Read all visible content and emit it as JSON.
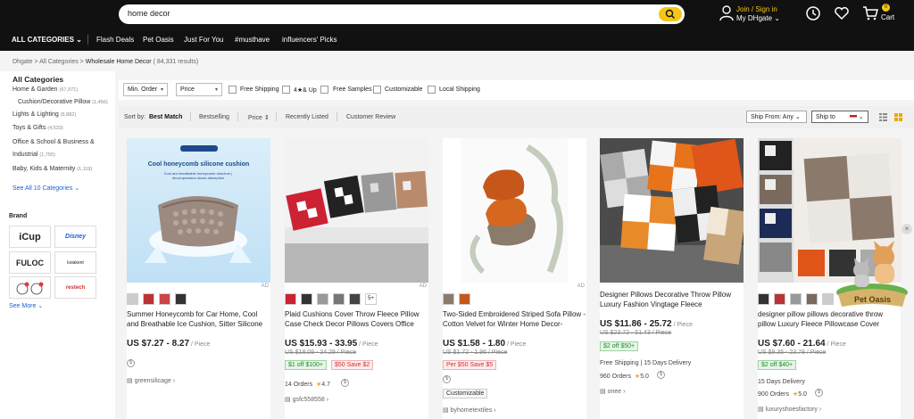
{
  "header": {
    "search_value": "home decor",
    "join_label": "Join / Sign in",
    "my_label": "My DHgate",
    "cart_count": "0",
    "cart_label": "Cart"
  },
  "nav": {
    "all_categories": "ALL CATEGORIES",
    "items": [
      "Flash Deals",
      "Pet Oasis",
      "Just For You",
      "#musthave",
      "influencers' Picks"
    ]
  },
  "breadcrumb": {
    "path": "Dhgate > All Categories > ",
    "current": "Wholesale Home Decor",
    "results": " ( 84,331  results)"
  },
  "sidebar": {
    "title": "All Categories",
    "items": [
      {
        "label": "Home & Garden",
        "count": "(67,971)"
      },
      {
        "label": "Cushion/Decorative Pillow",
        "count": "(1,456)"
      },
      {
        "label": "Lights & Lighting",
        "count": "(5,882)"
      },
      {
        "label": "Toys & Gifts",
        "count": "(4,533)"
      },
      {
        "label": "Office & School & Business &",
        "count": ""
      },
      {
        "label": "Industrial",
        "count": "(1,755)"
      },
      {
        "label": "Baby, Kids & Maternity",
        "count": "(1,119)"
      }
    ],
    "see_all": "See All 10 Categories",
    "brand_title": "Brand",
    "brands": [
      "iCup",
      "Disney",
      "FULOC",
      "koiakent",
      "Hello Kitty",
      "restech"
    ],
    "see_more": "See More"
  },
  "filters": {
    "min_order": "Min. Order",
    "price": "Price",
    "free_shipping": "Free Shipping",
    "rating": "4★& Up",
    "free_samples": "Free Samples",
    "customizable": "Customizable",
    "local_shipping": "Local Shipping"
  },
  "sort": {
    "label": "Sort by:",
    "best": "Best Match",
    "bestselling": "Bestselling",
    "price": "Price",
    "recent": "Recently Listed",
    "review": "Customer Review",
    "ship_from": "Ship From:",
    "ship_from_val": "Any",
    "ship_to": "Ship to"
  },
  "products": [
    {
      "title": "Summer Honeycomb for Car Home, Cool and Breathable Ice Cushion, Sitter Silicone Egg...",
      "price": "US $7.27 - 8.27",
      "unit": " / Piece",
      "old_price": "",
      "coupons": [],
      "shipping": "",
      "orders": "",
      "rating": "",
      "store": "greensilicage",
      "img_caption_1": "Cool honeycomb silicone cushion",
      "img_caption_2": "Cool and breathable honeycomb structure | decompression shock absorption"
    },
    {
      "title": "Plaid Cushions Cover Throw Fleece Pillow Case Check Decor Pillows Covers Office Car...",
      "price": "US $15.93 - 33.95",
      "unit": " / Piece",
      "old_price": "US $18.09 - 34.29 / Piece",
      "coupons": [
        "$1 off $100+",
        "$50 Save $2"
      ],
      "shipping": "",
      "orders": "14 Orders",
      "rating": "4.7",
      "store": "gsfc558558",
      "more_thumbs": "5+"
    },
    {
      "title": "Two-Sided Embroidered Striped Sofa Pillow - Cotton Velvet for Winter Home Decor-BY1044",
      "price": "US $1.58 - 1.80",
      "unit": " / Piece",
      "old_price": "US $1.72 - 1.96 / Piece",
      "coupons": [
        "Per $50 Save $5"
      ],
      "shipping": "",
      "orders": "",
      "rating": "",
      "tag": "Customizable",
      "store": "byhometextiles"
    },
    {
      "title": "Designer Pillows Decorative Throw Pillow Luxury Fashion Vingtage Fleece Pillowcase...",
      "price": "US $11.86 - 25.72",
      "unit": " / Piece",
      "old_price": "US $23.72 - 51.43 / Piece",
      "coupons": [
        "$2 off $50+"
      ],
      "shipping": "Free Shipping  |  15 Days Delivery",
      "orders": "960 Orders",
      "rating": "5.0",
      "store": "onee"
    },
    {
      "title": "designer pillow pillows decorative throw pillow Luxury Fleece Pillowcase Cover Case...",
      "price": "US $7.60 - 21.64",
      "unit": " / Piece",
      "old_price": "US $8.35 - 23.78 / Piece",
      "coupons": [
        "$2 off $40+"
      ],
      "shipping": "15 Days Delivery",
      "orders": "900 Orders",
      "rating": "5.0",
      "store": "luxuryshoesfactory"
    }
  ],
  "ad_label": "AD",
  "pet_oasis": "Pet Oasis",
  "colors": {
    "accent": "#f5c518",
    "header": "#111111",
    "link": "#1b5fd6",
    "coupon_green": "#1e8a26",
    "coupon_red": "#d32f2f"
  }
}
